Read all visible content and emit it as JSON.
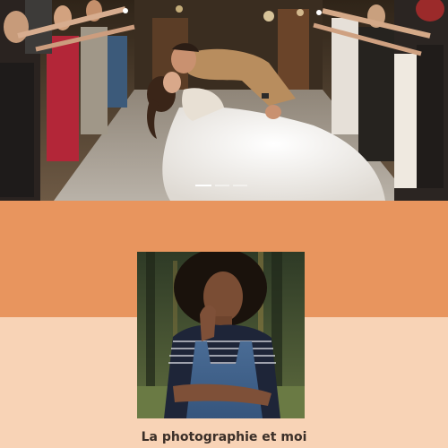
{
  "hero": {
    "image": "wedding-kiss-photo",
    "slides": [
      {
        "active": true
      },
      {
        "active": false
      },
      {
        "active": false
      }
    ]
  },
  "bands": {
    "top_color": "#e8955e",
    "bottom_color": "#f8d3b6"
  },
  "portrait": {
    "image": "portrait-photo"
  },
  "about": {
    "title": "La photographie et moi"
  }
}
